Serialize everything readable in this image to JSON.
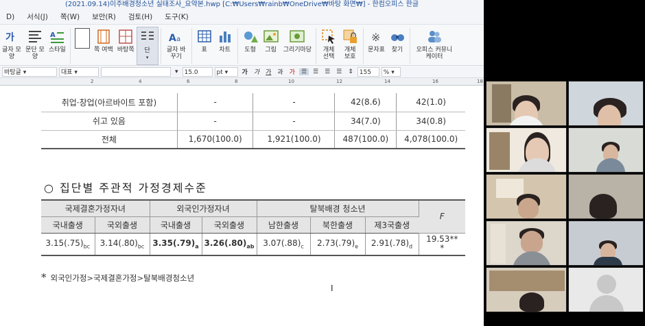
{
  "window": {
    "title": "(2021.09.14)이주배경청소년 실태조사_요약본.hwp [C:₩Users₩rainb₩OneDrive₩바탕 화면₩] - 한컴오피스 한글"
  },
  "menu": [
    "D)",
    "서식(J)",
    "쪽(W)",
    "보안(R)",
    "검토(H)",
    "도구(K)"
  ],
  "ribbon": [
    {
      "label": "글자 모양",
      "icon": "char-shape-icon"
    },
    {
      "label": "문단 모양",
      "icon": "paragraph-shape-icon"
    },
    {
      "label": "스타일",
      "icon": "style-icon"
    },
    {
      "label": "",
      "icon": "page-icon"
    },
    {
      "label": "쪽 여백",
      "icon": "page-margin-icon"
    },
    {
      "label": "바탕쪽",
      "icon": "master-page-icon"
    },
    {
      "label": "단",
      "icon": "columns-icon"
    },
    {
      "label": "글자 바꾸기",
      "icon": "change-char-icon"
    },
    {
      "label": "표",
      "icon": "table-icon"
    },
    {
      "label": "차트",
      "icon": "chart-icon"
    },
    {
      "label": "도형",
      "icon": "shape-icon"
    },
    {
      "label": "그림",
      "icon": "picture-icon"
    },
    {
      "label": "그리기마당",
      "icon": "drawing-gallery-icon"
    },
    {
      "label": "개체 선택",
      "icon": "object-select-icon"
    },
    {
      "label": "개체 보호",
      "icon": "object-protect-icon"
    },
    {
      "label": "문자표",
      "icon": "symbol-icon"
    },
    {
      "label": "찾기",
      "icon": "find-icon"
    },
    {
      "label": "오피스 커뮤니케이터",
      "icon": "office-communicator-icon"
    }
  ],
  "format_bar": {
    "style": "바탕글",
    "font_lang": "대표",
    "font": "",
    "size": "15.0",
    "size_unit": "pt",
    "zoom": "155",
    "zoom_unit": "%"
  },
  "ruler_ticks": [
    "2",
    "4",
    "6",
    "8",
    "10",
    "12",
    "14",
    "16",
    "18"
  ],
  "table1": {
    "rows": [
      [
        "취업·창업(아르바이트 포함)",
        "-",
        "-",
        "42(8.6)",
        "42(1.0)"
      ],
      [
        "쉬고 있음",
        "-",
        "-",
        "34(7.0)",
        "34(0.8)"
      ],
      [
        "전체",
        "1,670(100.0)",
        "1,921(100.0)",
        "487(100.0)",
        "4,078(100.0)"
      ]
    ]
  },
  "heading": "○ 집단별 주관적 가정경제수준",
  "table2": {
    "groups": [
      "국제결혼가정자녀",
      "외국인가정자녀",
      "탈북배경 청소년"
    ],
    "f_header": "F",
    "subheaders": [
      "국내출생",
      "국외출생",
      "국내출생",
      "국외출생",
      "남한출생",
      "북한출생",
      "제3국출생"
    ],
    "values": [
      {
        "v": "3.15(.75)",
        "s": "bc",
        "bold": false
      },
      {
        "v": "3.14(.80)",
        "s": "bc",
        "bold": false
      },
      {
        "v": "3.35(.79)",
        "s": "a",
        "bold": true
      },
      {
        "v": "3.26(.80)",
        "s": "ab",
        "bold": true
      },
      {
        "v": "3.07(.88)",
        "s": "c",
        "bold": false
      },
      {
        "v": "2.73(.79)",
        "s": "e",
        "bold": false
      },
      {
        "v": "2.91(.78)",
        "s": "d",
        "bold": false
      }
    ],
    "f_value": "19.53**",
    "f_value2": "*"
  },
  "footnote": {
    "mark": "*",
    "text": "외국인가정>국제결혼가정>탈북배경청소년"
  }
}
